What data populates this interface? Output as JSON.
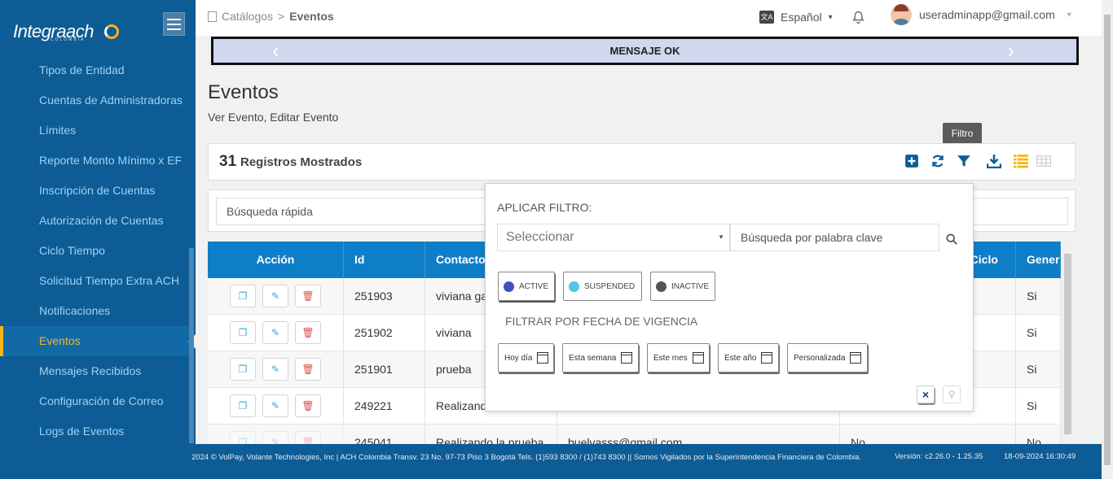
{
  "brand": {
    "name": "Integraach",
    "sub": "COLOMBIA"
  },
  "sidebar": {
    "items": [
      {
        "label": "Tipos de Entidad"
      },
      {
        "label": "Cuentas de Administradoras"
      },
      {
        "label": "Límites"
      },
      {
        "label": "Reporte Monto Mínimo x EF"
      },
      {
        "label": "Inscripción de Cuentas"
      },
      {
        "label": "Autorización de Cuentas"
      },
      {
        "label": "Ciclo Tiempo"
      },
      {
        "label": "Solicitud Tiempo Extra ACH"
      },
      {
        "label": "Notificaciones"
      },
      {
        "label": "Eventos",
        "active": true
      },
      {
        "label": "Mensajes Recibidos"
      },
      {
        "label": "Configuración de Correo"
      },
      {
        "label": "Logs de Eventos"
      }
    ]
  },
  "header": {
    "breadcrumb_root": "Catálogos",
    "breadcrumb_sep": ">",
    "breadcrumb_current": "Eventos",
    "language": "Español",
    "user_email": "useradminapp@gmail.com"
  },
  "banner": {
    "message": "MENSAJE OK"
  },
  "page": {
    "title": "Eventos",
    "subtitle": "Ver Evento, Editar Evento"
  },
  "records": {
    "count": "31",
    "label": "Registros Mostrados"
  },
  "tooltip": "Filtro",
  "quick_search": {
    "placeholder": "Búsqueda rápida"
  },
  "table": {
    "headers": [
      "Acción",
      "Id",
      "Contacto",
      "",
      "e Ciclo",
      "Gener"
    ],
    "rows": [
      {
        "id": "251903",
        "contacto": "viviana ga",
        "email": "",
        "ciclo": "",
        "gen": "Si"
      },
      {
        "id": "251902",
        "contacto": "viviana",
        "email": "",
        "ciclo": "",
        "gen": "Si"
      },
      {
        "id": "251901",
        "contacto": "prueba",
        "email": "",
        "ciclo": "",
        "gen": "Si"
      },
      {
        "id": "249221",
        "contacto": "Realizando",
        "email": "",
        "ciclo": "",
        "gen": "Si"
      },
      {
        "id": "245041",
        "contacto": "Realizando la prueba",
        "email": "buelvasss@gmail.com",
        "ciclo": "No",
        "gen": "No"
      }
    ]
  },
  "filter": {
    "title": "APLICAR FILTRO:",
    "select_placeholder": "Seleccionar",
    "keyword_placeholder": "Búsqueda por palabra clave",
    "statuses": [
      {
        "label": "ACTIVE",
        "color": "#3f4fbf"
      },
      {
        "label": "SUSPENDED",
        "color": "#4fc8e0"
      },
      {
        "label": "INACTIVE",
        "color": "#555555"
      }
    ],
    "date_title": "FILTRAR POR FECHA DE VIGENCIA",
    "dates": [
      "Hoy día",
      "Esta semana",
      "Este mes",
      "Este año",
      "Personalizada"
    ],
    "clear_symbol": "×"
  },
  "footer": {
    "text": "2024 © VolPay, Volante Technologies, Inc | ACH Colombia Transv. 23 No. 97-73 Piso 3 Bogotá Tels. (1)593 8300 / (1)743 8300 || Somos Vigilados por la Superintendencia Financiera de Colombia.",
    "version": "Versión: c2.26.0 - 1.25.35",
    "datetime": "18-09-2024 16:30:49"
  },
  "colors": {
    "sidebar": "#0d5c95",
    "accent": "#f5b51b",
    "table_header": "#0f7ec8"
  }
}
